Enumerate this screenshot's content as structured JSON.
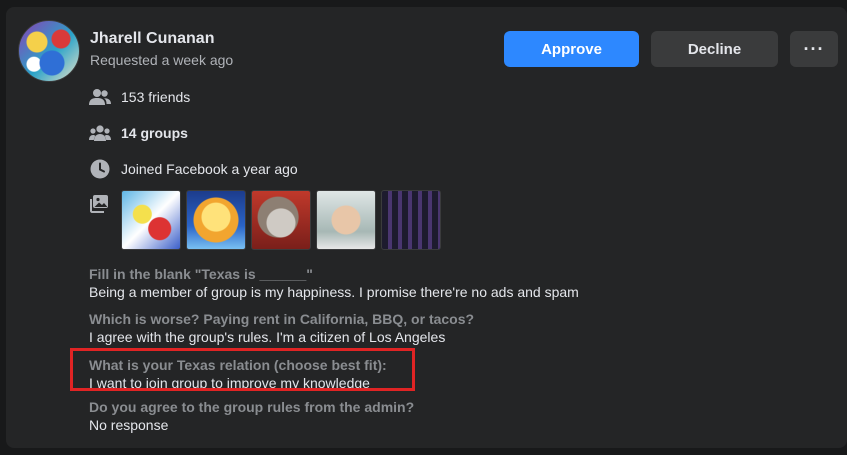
{
  "member": {
    "name": "Jharell Cunanan",
    "requested": "Requested a week ago"
  },
  "actions": {
    "approve_label": "Approve",
    "decline_label": "Decline",
    "more_label": "···"
  },
  "info": {
    "friends": "153 friends",
    "groups": "14 groups",
    "joined": "Joined Facebook a year ago"
  },
  "icons": {
    "friends": "friends-icon",
    "groups": "groups-icon",
    "joined": "clock-icon",
    "photos": "photos-icon"
  },
  "photos_count": 5,
  "answers": [
    {
      "question": "Fill in the blank \"Texas is ______\"",
      "answer": "Being a member of group is my happiness. I promise there're no ads and spam"
    },
    {
      "question": "Which is worse? Paying rent in California, BBQ, or tacos?",
      "answer": "I agree with the group's rules. I'm a citizen of Los Angeles"
    },
    {
      "question": "What is your Texas relation (choose best fit):",
      "answer": "I want to join group to improve my knowledge"
    },
    {
      "question": "Do you agree to the group rules from the admin?",
      "answer": "No response"
    }
  ],
  "colors": {
    "background": "#18191a",
    "card": "#242526",
    "approve": "#2d88ff",
    "secondary_button": "#3a3b3c",
    "highlight": "#e02424",
    "question_text": "#8a8d91"
  }
}
